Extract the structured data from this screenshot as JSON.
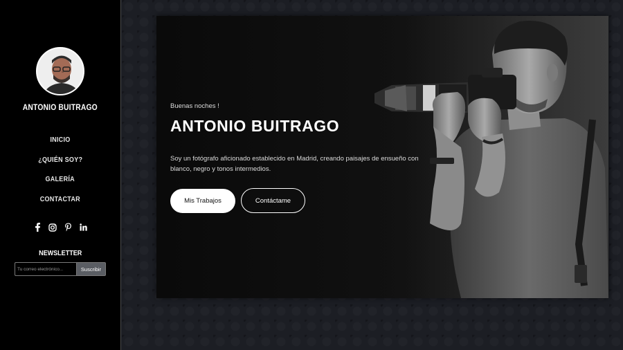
{
  "sidebar": {
    "name": "ANTONIO BUITRAGO",
    "nav": [
      {
        "label": "INICIO"
      },
      {
        "label": "¿QUIÉN SOY?"
      },
      {
        "label": "GALERÍA"
      },
      {
        "label": "CONTACTAR"
      }
    ],
    "socials": [
      "facebook-icon",
      "instagram-icon",
      "pinterest-icon",
      "linkedin-icon"
    ],
    "newsletter": {
      "title": "NEWSLETTER",
      "placeholder": "Tu correo electrónico...",
      "button": "Suscribir"
    }
  },
  "hero": {
    "greeting": "Buenas noches !",
    "title": "ANTONIO BUITRAGO",
    "description": "Soy un fotógrafo aficionado establecido en Madrid, creando paisajes de ensueño con blanco, negro y tonos intermedios.",
    "primary_button": "Mis Trabajos",
    "secondary_button": "Contáctame"
  },
  "colors": {
    "sidebar_bg": "#000000",
    "page_bg": "#1c1e24",
    "accent": "#ffffff"
  }
}
